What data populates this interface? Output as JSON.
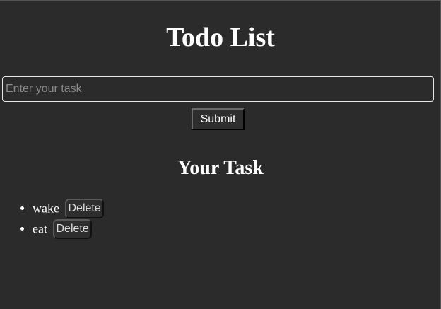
{
  "page": {
    "title": "Todo List"
  },
  "form": {
    "input_placeholder": "Enter your task",
    "input_value": "",
    "submit_label": "Submit"
  },
  "tasks_section": {
    "title": "Your Task",
    "items": [
      {
        "text": "wake",
        "delete_label": "Delete"
      },
      {
        "text": "eat",
        "delete_label": "Delete"
      }
    ]
  },
  "colors": {
    "background": "#2b2b2b",
    "text": "#ffffff",
    "input_border": "#e6e6e6",
    "placeholder": "#8a8a8a"
  }
}
